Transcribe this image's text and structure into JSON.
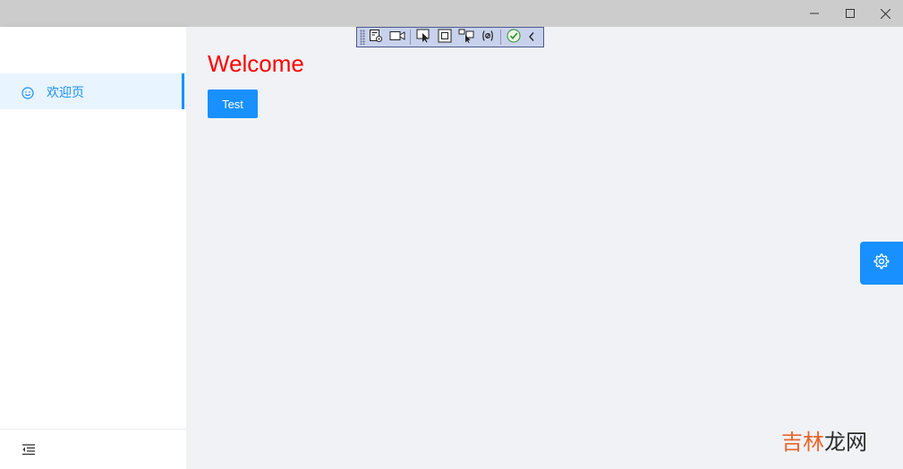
{
  "window": {
    "minimize_icon": "minimize-icon",
    "maximize_icon": "maximize-icon",
    "close_icon": "close-icon"
  },
  "sidebar": {
    "items": [
      {
        "label": "欢迎页",
        "icon": "smile-icon",
        "active": true
      }
    ],
    "footer_icon": "menu-fold-icon"
  },
  "main": {
    "heading": "Welcome",
    "button_label": "Test"
  },
  "debug_toolbar": {
    "icons": [
      "grip-icon",
      "live-tree-icon",
      "record-icon",
      "select-element-icon",
      "layout-adorner-icon",
      "track-focus-icon",
      "binding-failures-icon",
      "hot-reload-check-icon",
      "collapse-toolbar-icon"
    ]
  },
  "settings_button_icon": "gear-icon",
  "watermark": {
    "part1": "吉林",
    "part2": "龙网"
  },
  "colors": {
    "accent": "#1890ff",
    "heading": "#ff0000",
    "content_bg": "#f0f2f5",
    "titlebar_bg": "#cccccc",
    "toolbar_bg": "#c9d2ec"
  }
}
